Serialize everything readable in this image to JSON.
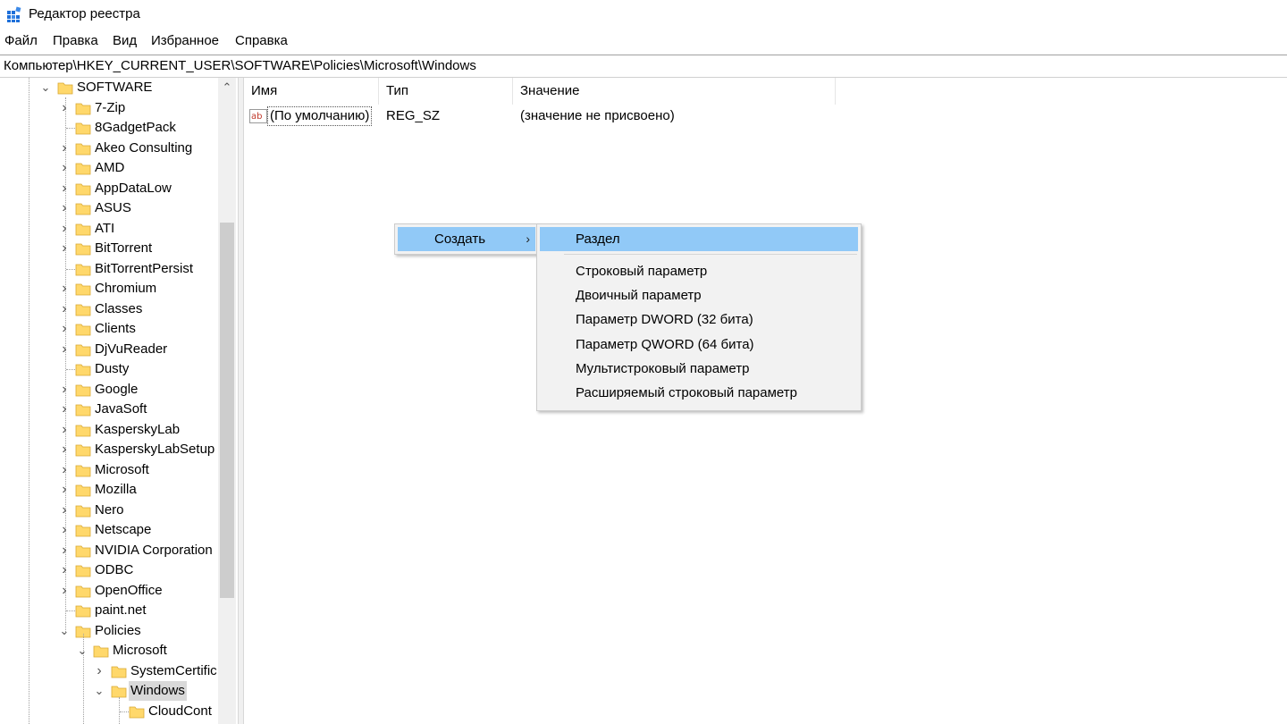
{
  "window": {
    "title": "Редактор реестра"
  },
  "menu": [
    "Файл",
    "Правка",
    "Вид",
    "Избранное",
    "Справка"
  ],
  "address": "Компьютер\\HKEY_CURRENT_USER\\SOFTWARE\\Policies\\Microsoft\\Windows",
  "tree": {
    "root": {
      "label": "SOFTWARE",
      "expanded": true
    },
    "children": [
      "7-Zip",
      "8GadgetPack",
      "Akeo Consulting",
      "AMD",
      "AppDataLow",
      "ASUS",
      "ATI",
      "BitTorrent",
      "BitTorrentPersist",
      "Chromium",
      "Classes",
      "Clients",
      "DjVuReader",
      "Dusty",
      "Google",
      "JavaSoft",
      "KasperskyLab",
      "KasperskyLabSetup",
      "Microsoft",
      "Mozilla",
      "Nero",
      "Netscape",
      "NVIDIA Corporation",
      "ODBC",
      "OpenOffice",
      "paint.net",
      "Policies"
    ],
    "no_children": [
      "8GadgetPack",
      "BitTorrentPersist",
      "Dusty",
      "paint.net"
    ],
    "policies_child": "Microsoft",
    "microsoft_children": [
      "SystemCertific",
      "Windows"
    ],
    "windows_children": [
      "CloudCont"
    ],
    "selected": "Windows"
  },
  "list": {
    "columns": [
      "Имя",
      "Тип",
      "Значение"
    ],
    "rows": [
      {
        "name": "(По умолчанию)",
        "type": "REG_SZ",
        "value": "(значение не присвоено)",
        "icon": "string-value-icon"
      }
    ]
  },
  "context_menu": {
    "item": "Создать",
    "submenu": [
      "Раздел",
      "Строковый параметр",
      "Двоичный параметр",
      "Параметр DWORD (32 бита)",
      "Параметр QWORD (64 бита)",
      "Мультистроковый параметр",
      "Расширяемый строковый параметр"
    ],
    "highlighted": "Раздел"
  },
  "colors": {
    "highlight": "#91c9f7",
    "selection": "#d9d9d9",
    "folder": "#ffd86b"
  }
}
